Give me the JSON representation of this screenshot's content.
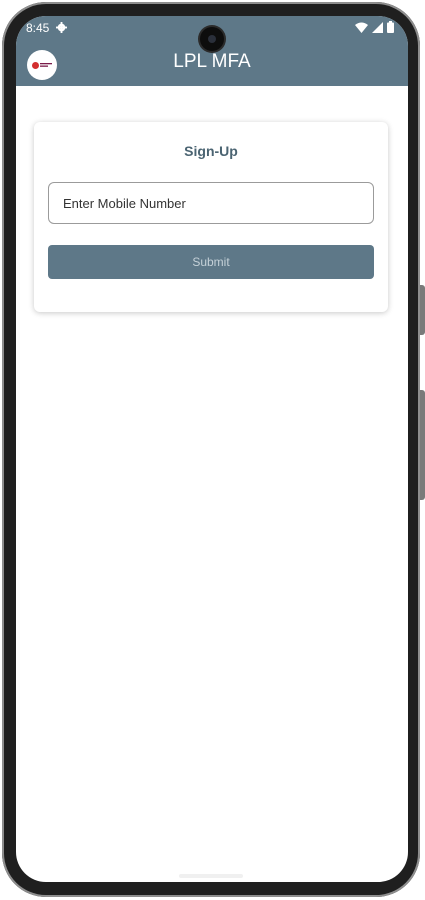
{
  "status_bar": {
    "time": "8:45",
    "settings_icon": "gear-icon",
    "wifi_icon": "wifi-icon",
    "signal_icon": "signal-icon",
    "battery_icon": "battery-icon"
  },
  "app_bar": {
    "logo_icon": "app-logo",
    "title": "LPL MFA",
    "background_color": "#5e7888"
  },
  "signup_card": {
    "title": "Sign-Up",
    "mobile_input": {
      "placeholder": "Enter Mobile Number",
      "value": ""
    },
    "submit_label": "Submit"
  },
  "colors": {
    "accent": "#5e7888",
    "title_text": "#4b6472",
    "submit_text": "#c5d1d8"
  }
}
